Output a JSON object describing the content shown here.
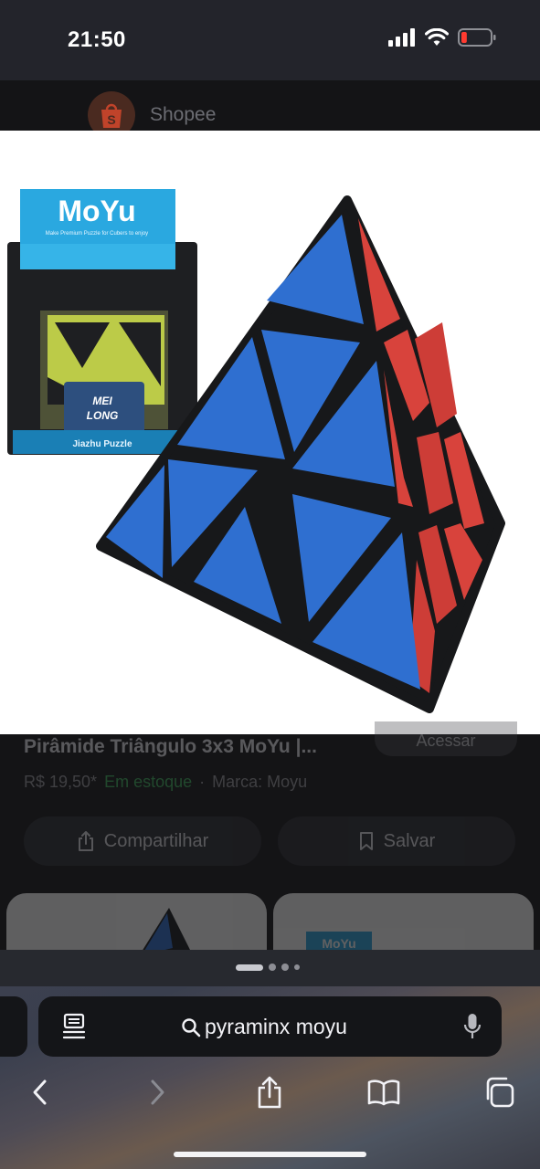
{
  "status_bar": {
    "time": "21:50",
    "battery_level": 0.15,
    "battery_color": "#ff3b30"
  },
  "store": {
    "name": "Shopee",
    "logo_letter": "S",
    "brand_color": "#ee4d2d"
  },
  "product": {
    "box_brand": "MoYu",
    "box_tagline": "Make Premium Puzzle for Cubers to enjoy",
    "box_logo_line1": "MEI",
    "box_logo_line2": "LONG",
    "box_series": "Jiazhu Puzzle",
    "visit_label": "Acessar",
    "title": "Pirâmide Triângulo 3x3 MoYu |...",
    "price": "R$ 19,50*",
    "separator": "·",
    "stock": "Em estoque",
    "brand": "Marca: Moyu",
    "colors": {
      "face_left": "#2f6fd0",
      "face_right": "#d8433c",
      "frame": "#17181a"
    }
  },
  "actions": {
    "share_label": "Compartilhar",
    "save_label": "Salvar"
  },
  "related": [
    {
      "icon": "pyraminx-thumbnail"
    },
    {
      "label": "MoYu"
    }
  ],
  "browser": {
    "tab_page_count": 4,
    "tab_page_active": 1,
    "query": "pyraminx moyu",
    "icons": [
      "reader-icon",
      "search-icon",
      "mic-icon",
      "back-chevron-icon",
      "forward-chevron-icon",
      "share-icon",
      "bookmarks-icon",
      "tabs-icon"
    ]
  }
}
